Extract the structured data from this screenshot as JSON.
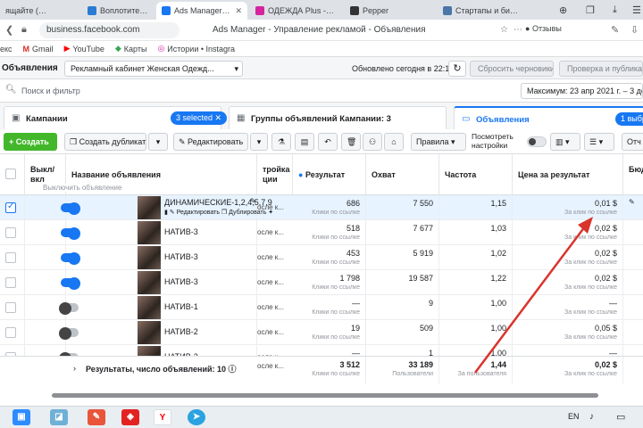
{
  "browser": {
    "tabs": [
      {
        "label": "ящайте (7) - nastya"
      },
      {
        "label": "Воплотите Свой биз"
      },
      {
        "label": "Ads Manager - Упр"
      },
      {
        "label": "ОДЕЖДА Plus - Size"
      },
      {
        "label": "Pepper"
      },
      {
        "label": "Стартапы и бизнес"
      }
    ],
    "url": "business.facebook.com",
    "page_title": "Ads Manager - Управление рекламой - Объявления",
    "reviews": "Отзывы"
  },
  "bookmarks": [
    {
      "label": "екс",
      "icon": "yandex"
    },
    {
      "label": "Gmail",
      "icon": "gmail"
    },
    {
      "label": "YouTube",
      "icon": "youtube"
    },
    {
      "label": "Карты",
      "icon": "maps"
    },
    {
      "label": "Истории • Instagra",
      "icon": "instagram"
    }
  ],
  "header": {
    "title": "Объявления",
    "account": "Рекламный кабинет Женская Одежд...",
    "updated": "Обновлено сегодня в 22:13",
    "discard": "Сбросить черновики",
    "review_publish": "Проверка и публикация"
  },
  "search": {
    "placeholder": "Поиск и фильтр",
    "date_range": "Максимум: 23 апр 2021 г. – 3 дек 20"
  },
  "panels": {
    "campaigns": "Кампании",
    "campaigns_selected": "3 selected",
    "adsets": "Группы объявлений Кампании: 3",
    "ads": "Объявления",
    "ads_selected": "1 выбр"
  },
  "toolbar": {
    "create": "Создать",
    "duplicate": "Создать дубликат",
    "edit": "Редактировать",
    "rules": "Правила",
    "view_settings": "Посмотреть настройки",
    "reports": "Отч"
  },
  "table": {
    "columns": {
      "onoff": "Выкл/вкл",
      "name": "Название объявления",
      "delivery": "тройка ции",
      "result": "Результат",
      "reach": "Охват",
      "frequency": "Частота",
      "cpr": "Цена за результат",
      "budget": "Бюд"
    },
    "tooltip": "Выключить объявление",
    "edit_link": "Редактировать",
    "dup_link": "Дублировать",
    "rows": [
      {
        "name": "ДИНАМИЧЕСКИЕ-1,2,4,5,7,9",
        "on": true,
        "selected": true,
        "delivery": "осле к...",
        "result": "686",
        "result_sub": "Клики по ссылке",
        "reach": "7 550",
        "freq": "1,15",
        "cpr": "0,01 $",
        "cpr_sub": "За клик по ссылке"
      },
      {
        "name": "НАТИВ-3",
        "on": true,
        "selected": false,
        "delivery": "осле к...",
        "result": "518",
        "result_sub": "Клики по ссылке",
        "reach": "7 677",
        "freq": "1,03",
        "cpr": "0,02 $",
        "cpr_sub": "За клик по ссылке"
      },
      {
        "name": "НАТИВ-3",
        "on": true,
        "selected": false,
        "delivery": "осле к...",
        "result": "453",
        "result_sub": "Клики по ссылке",
        "reach": "5 919",
        "freq": "1,02",
        "cpr": "0,02 $",
        "cpr_sub": "За клик по ссылке"
      },
      {
        "name": "НАТИВ-3",
        "on": true,
        "selected": false,
        "delivery": "осле к...",
        "result": "1 798",
        "result_sub": "Клики по ссылке",
        "reach": "19 587",
        "freq": "1,22",
        "cpr": "0,02 $",
        "cpr_sub": "За клик по ссылке"
      },
      {
        "name": "НАТИВ-1",
        "on": false,
        "selected": false,
        "delivery": "осле к...",
        "result": "—",
        "result_sub": "Клики по ссылке",
        "reach": "9",
        "freq": "1,00",
        "cpr": "—",
        "cpr_sub": "За клик по ссылке"
      },
      {
        "name": "НАТИВ-2",
        "on": false,
        "selected": false,
        "delivery": "осле к...",
        "result": "19",
        "result_sub": "Клики по ссылке",
        "reach": "509",
        "freq": "1,00",
        "cpr": "0,05 $",
        "cpr_sub": "За клик по ссылке"
      },
      {
        "name": "НАТИВ-2",
        "on": false,
        "selected": false,
        "delivery": "осле к...",
        "result": "—",
        "result_sub": "Клики по ссылке",
        "reach": "1",
        "freq": "1,00",
        "cpr": "—",
        "cpr_sub": "За клик по ссылке"
      }
    ],
    "totals": {
      "label": "Результаты, число объявлений: 10",
      "delivery": "осле к...",
      "result": "3 512",
      "result_sub": "Клики по ссылке",
      "reach": "33 189",
      "reach_sub": "Пользователи",
      "freq": "1,44",
      "freq_sub": "За пользователя",
      "cpr": "0,02 $",
      "cpr_sub": "За клик по ссылке"
    }
  },
  "taskbar": {
    "lang": "EN"
  },
  "colors": {
    "accent": "#1877f2",
    "create": "#42b72a",
    "arrow": "#d9342b"
  }
}
